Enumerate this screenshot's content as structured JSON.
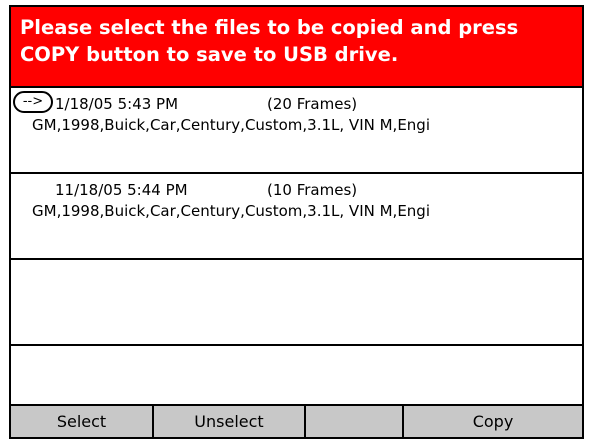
{
  "header": {
    "line1": "Please select the files to be copied and press",
    "line2": "COPY button to save to USB drive."
  },
  "cursor": {
    "glyph": "-->"
  },
  "files": [
    {
      "datetime": "1/18/05 5:43 PM",
      "frames": "(20 Frames)",
      "description": "GM,1998,Buick,Car,Century,Custom,3.1L, VIN M,Engi",
      "selected": true
    },
    {
      "datetime": "11/18/05 5:44 PM",
      "frames": "(10 Frames)",
      "description": "GM,1998,Buick,Car,Century,Custom,3.1L, VIN M,Engi",
      "selected": false
    }
  ],
  "toolbar": {
    "select_label": "Select",
    "unselect_label": "Unselect",
    "blank_label": "",
    "copy_label": "Copy"
  },
  "colors": {
    "header_bg": "#ff0000",
    "header_text": "#ffffff",
    "toolbar_bg": "#c8c8c8"
  }
}
